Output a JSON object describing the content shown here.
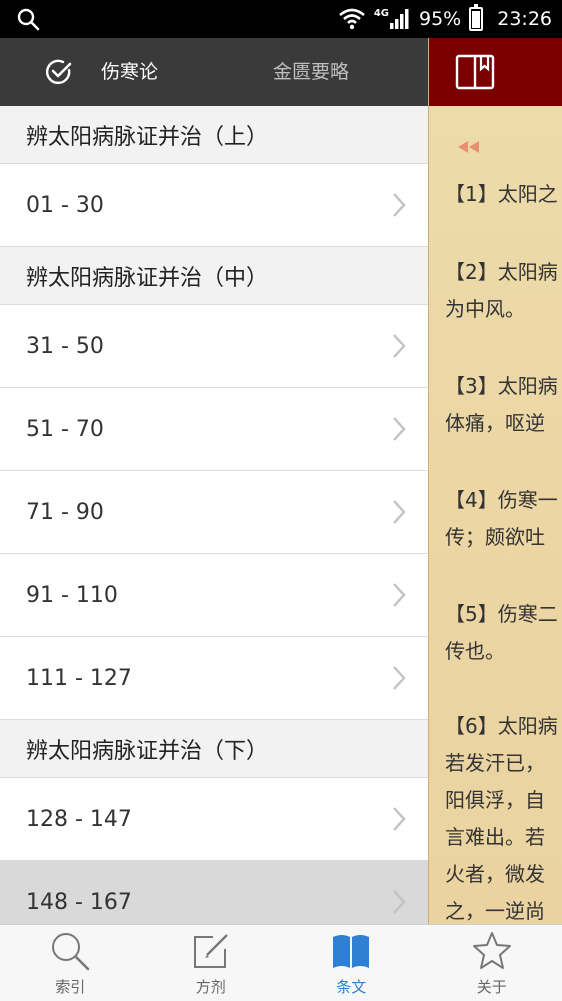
{
  "status_bar": {
    "network": "4G",
    "battery": "95%",
    "battery_level": 0.95,
    "time": "23:26"
  },
  "top_tabs": [
    {
      "label": "伤寒论",
      "selected": true
    },
    {
      "label": "金匮要略",
      "selected": false
    }
  ],
  "sections": [
    {
      "title": "辨太阳病脉证并治（上）",
      "items": [
        "01 - 30"
      ]
    },
    {
      "title": "辨太阳病脉证并治（中）",
      "items": [
        "31 - 50",
        "51 - 70",
        "71 - 90",
        "91 - 110",
        "111 - 127"
      ]
    },
    {
      "title": "辨太阳病脉证并治（下）",
      "items": [
        "128 - 147",
        "148 - 167"
      ]
    }
  ],
  "selected_item": "148 - 167",
  "reader": {
    "lines": [
      "【1】太阳之",
      "【2】太阳病",
      "为中风。",
      "【3】太阳病",
      "体痛，呕逆",
      "【4】伤寒一",
      "传；颇欲吐",
      "【5】伤寒二",
      "传也。",
      "【6】太阳病",
      "若发汗已，",
      "阳俱浮，自",
      "言难出。若",
      "火者，微发",
      "之，一逆尚"
    ]
  },
  "bottom_nav": [
    {
      "label": "索引",
      "icon": "search-icon",
      "active": false
    },
    {
      "label": "方剂",
      "icon": "edit-icon",
      "active": false
    },
    {
      "label": "条文",
      "icon": "book-icon",
      "active": true
    },
    {
      "label": "关于",
      "icon": "star-icon",
      "active": false
    }
  ],
  "colors": {
    "top_bar": "#3a3a3a",
    "right_header": "#7a0000",
    "reader_bg": "#ecd7a6",
    "accent": "#2f7fd3",
    "rewind": "#e8906f"
  }
}
